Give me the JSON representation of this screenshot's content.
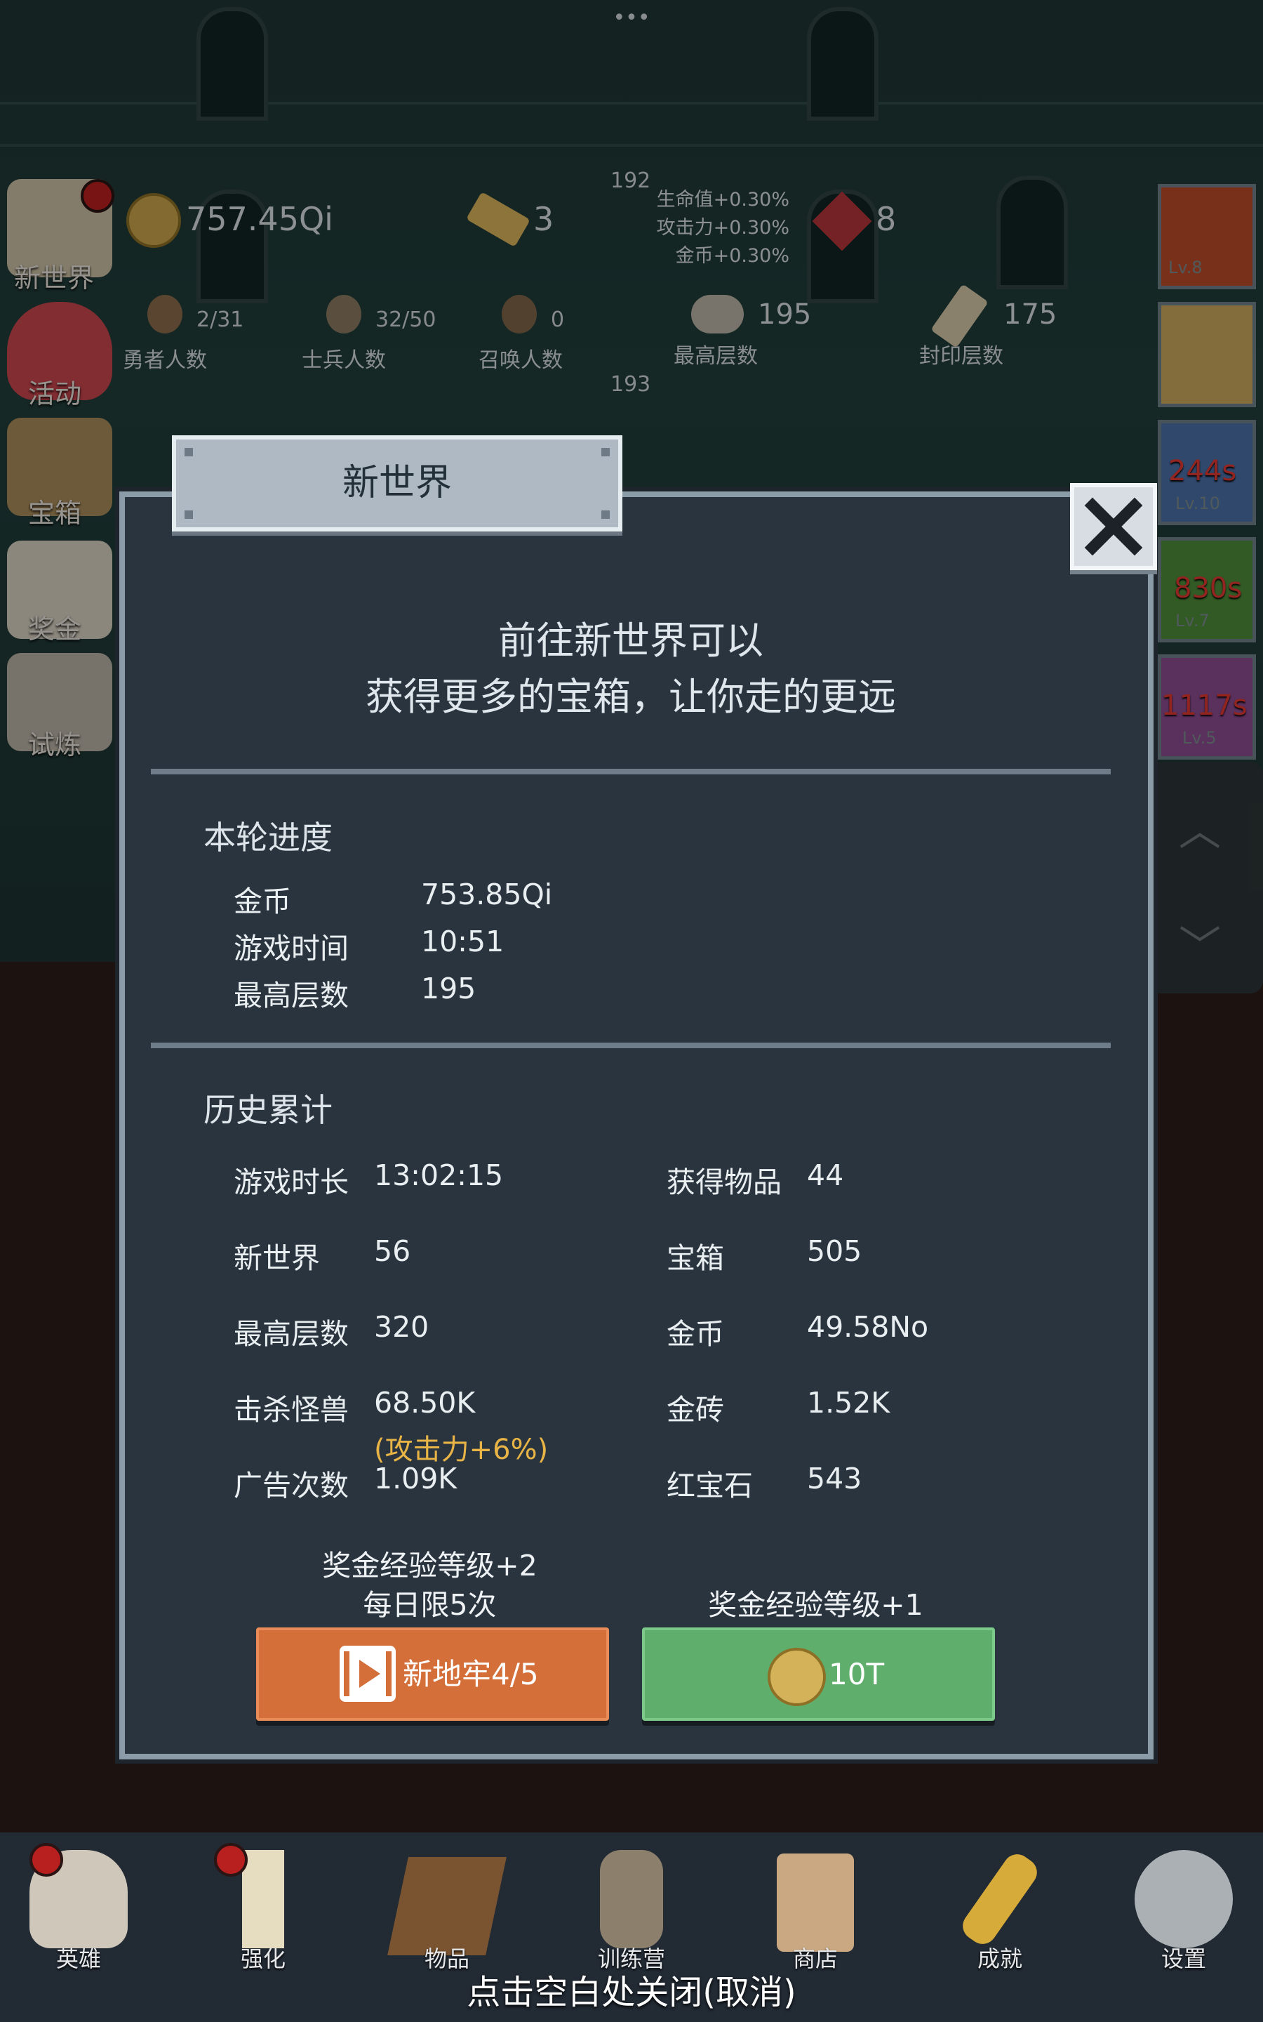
{
  "top_hint": "•••",
  "hud": {
    "gold": "757.45Qi",
    "gold_bar": "3",
    "gem": "8",
    "floor_a": "192",
    "floor_b": "193",
    "buffs": [
      "生命值+0.30%",
      "攻击力+0.30%",
      "金币+0.30%"
    ],
    "stats": [
      {
        "value": "2/31",
        "label": "勇者人数"
      },
      {
        "value": "32/50",
        "label": "士兵人数"
      },
      {
        "value": "0",
        "label": "召唤人数"
      },
      {
        "value": "195",
        "label": "最高层数"
      },
      {
        "value": "175",
        "label": "封印层数"
      }
    ]
  },
  "side_menu": [
    "新世界",
    "活动",
    "宝箱",
    "奖金",
    "试炼"
  ],
  "right_rail": {
    "levels": [
      "Lv.8",
      "Lv.10",
      "Lv.7",
      "Lv.5"
    ],
    "timers": [
      "244s",
      "830s",
      "1117s"
    ]
  },
  "dialog": {
    "title": "新世界",
    "intro_line1": "前往新世界可以",
    "intro_line2": "获得更多的宝箱，让你走的更远",
    "round_title": "本轮进度",
    "round_rows": [
      {
        "label": "金币",
        "value": "753.85Qi"
      },
      {
        "label": "游戏时间",
        "value": "10:51"
      },
      {
        "label": "最高层数",
        "value": "195"
      }
    ],
    "history_title": "历史累计",
    "history_left": [
      {
        "label": "游戏时长",
        "value": "13:02:15"
      },
      {
        "label": "新世界",
        "value": "56"
      },
      {
        "label": "最高层数",
        "value": "320"
      },
      {
        "label": "击杀怪兽",
        "value": "68.50K"
      },
      {
        "label": "广告次数",
        "value": "1.09K"
      }
    ],
    "history_note": "(攻击力+6%)",
    "history_right": [
      {
        "label": "获得物品",
        "value": "44"
      },
      {
        "label": "宝箱",
        "value": "505"
      },
      {
        "label": "金币",
        "value": "49.58No"
      },
      {
        "label": "金砖",
        "value": "1.52K"
      },
      {
        "label": "红宝石",
        "value": "543"
      }
    ],
    "left_caption1": "奖金经验等级+2",
    "left_caption2": "每日限5次",
    "right_caption": "奖金经验等级+1",
    "ad_button": "新地牢4/5",
    "coin_button": "10T"
  },
  "bottom_nav": [
    "英雄",
    "强化",
    "物品",
    "训练营",
    "商店",
    "成就",
    "设置"
  ],
  "dismiss_hint": "点击空白处关闭(取消)",
  "colors": {
    "panel": "#2a343f",
    "orange_btn": "#d46f3a",
    "green_btn": "#5fae6c",
    "note": "#e8b446",
    "timer": "#e23a32"
  }
}
